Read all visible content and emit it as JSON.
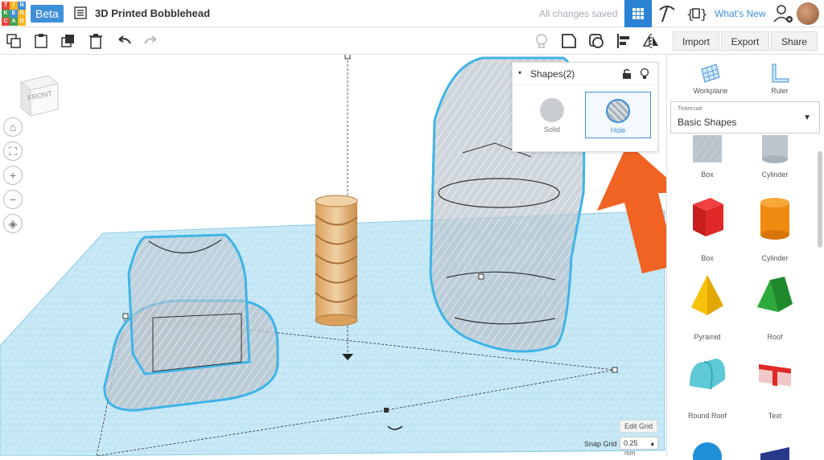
{
  "app": {
    "logo_letters": [
      "T",
      "I",
      "N",
      "K",
      "E",
      "R",
      "C",
      "A",
      "D"
    ],
    "logo_colors": [
      "#e8453c",
      "#f7b523",
      "#3f8fd8",
      "#3fa34d",
      "#3f8fd8",
      "#f7b523",
      "#e8453c",
      "#3fa34d",
      "#f7b523"
    ],
    "beta_label": "Beta",
    "doc_title": "3D Printed Bobblehead",
    "save_status": "All changes saved",
    "whats_new": "What's New"
  },
  "toolbar": {
    "import_label": "Import",
    "export_label": "Export",
    "share_label": "Share"
  },
  "viewcube": {
    "face_label": "FRONT"
  },
  "shapes_panel": {
    "title": "Shapes(2)",
    "options": [
      {
        "label": "Solid",
        "selected": false
      },
      {
        "label": "Hole",
        "selected": true
      }
    ]
  },
  "sidebar": {
    "workplane_label": "Workplane",
    "ruler_label": "Ruler",
    "library_small": "Tinkercad",
    "library_name": "Basic Shapes",
    "shapes": [
      {
        "label": "Box",
        "icon": "box-hole-icon"
      },
      {
        "label": "Cylinder",
        "icon": "cylinder-hole-icon"
      },
      {
        "label": "Box",
        "icon": "box-icon"
      },
      {
        "label": "Cylinder",
        "icon": "cylinder-icon"
      },
      {
        "label": "Pyramid",
        "icon": "pyramid-icon"
      },
      {
        "label": "Roof",
        "icon": "roof-icon"
      },
      {
        "label": "Round Roof",
        "icon": "round-roof-icon"
      },
      {
        "label": "Text",
        "icon": "text-icon"
      }
    ]
  },
  "grid": {
    "edit_grid_label": "Edit Grid",
    "snap_grid_label": "Snap Grid",
    "snap_value": "0.25",
    "snap_unit": "mm"
  },
  "colors": {
    "accent": "#2a82d4",
    "hole_arrow": "#f06322",
    "workplane": "#bfe4f4",
    "outline": "#3fb4e8",
    "spring": "#e8c08a"
  }
}
